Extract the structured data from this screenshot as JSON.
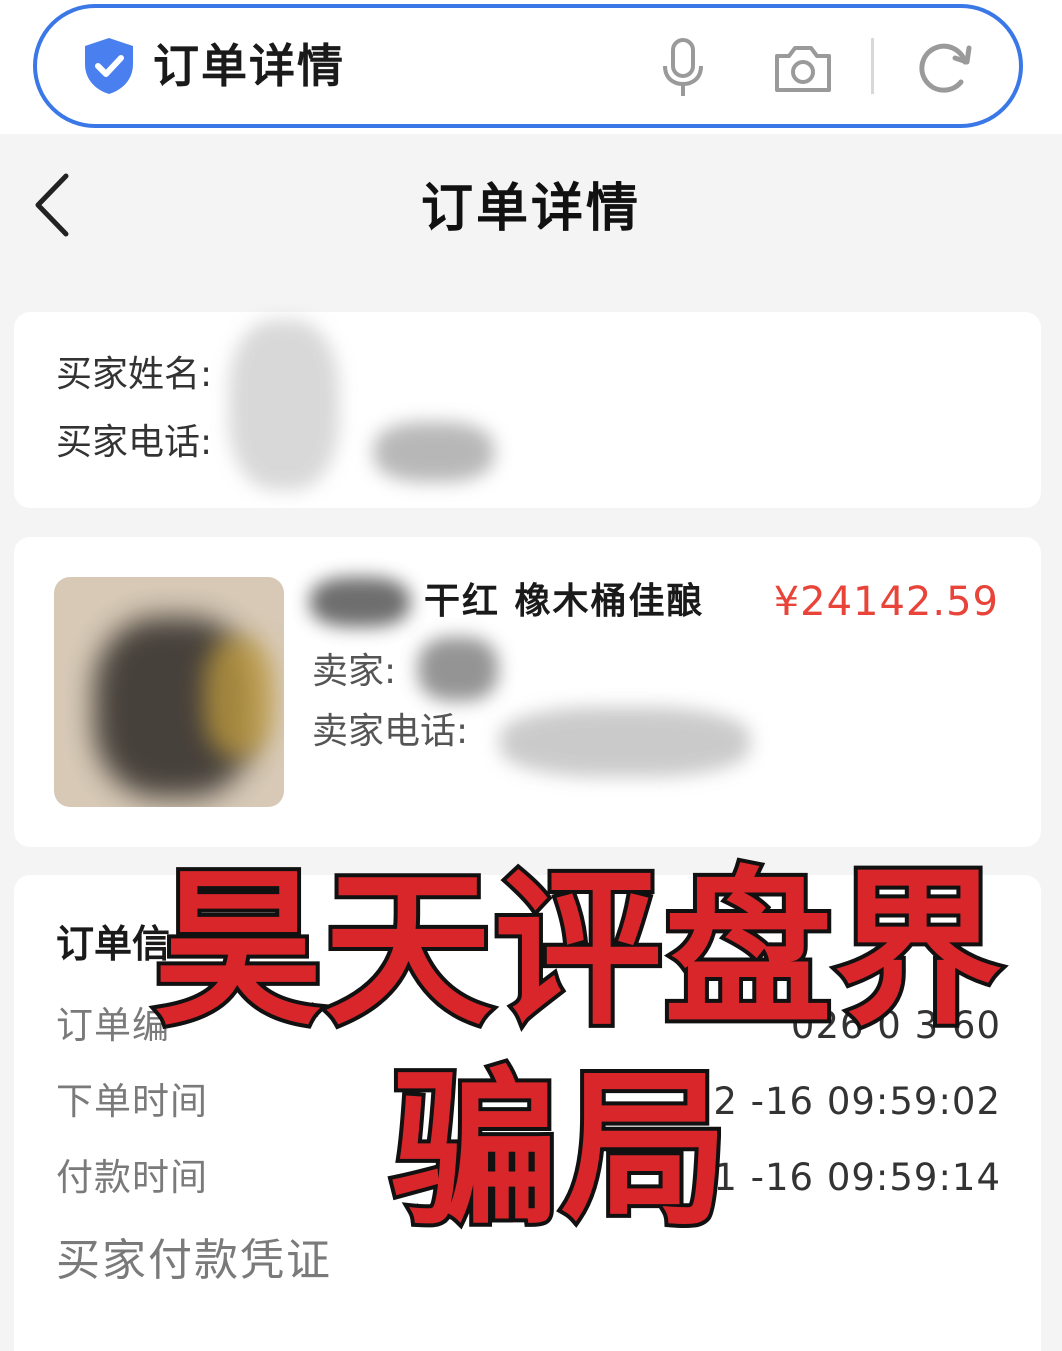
{
  "browser": {
    "address_title": "订单详情",
    "icons": [
      "shield-check-icon",
      "microphone-icon",
      "camera-icon",
      "refresh-icon"
    ]
  },
  "header": {
    "title": "订单详情",
    "back_icon": "chevron-left-icon"
  },
  "buyer": {
    "name_label": "买家姓名:",
    "phone_label": "买家电话:"
  },
  "product": {
    "name": "干红 橡木桶佳酿",
    "price": "¥24142.59",
    "seller_label": "卖家:",
    "seller_phone_label": "卖家电话:"
  },
  "order": {
    "section_title": "订单信",
    "rows": [
      {
        "label": "订单编",
        "value": "026   0  3  60"
      },
      {
        "label": "下单时间",
        "value": "2     -16 09:59:02"
      },
      {
        "label": "付款时间",
        "value": "1      -16 09:59:14"
      }
    ],
    "payment_proof_label": "买家付款凭证"
  },
  "watermark": {
    "line1": "昊天评盘界",
    "line2": "骗局"
  },
  "colors": {
    "accent_blue": "#3a78e8",
    "price_red": "#e8443a",
    "watermark_red": "#d8262b"
  }
}
